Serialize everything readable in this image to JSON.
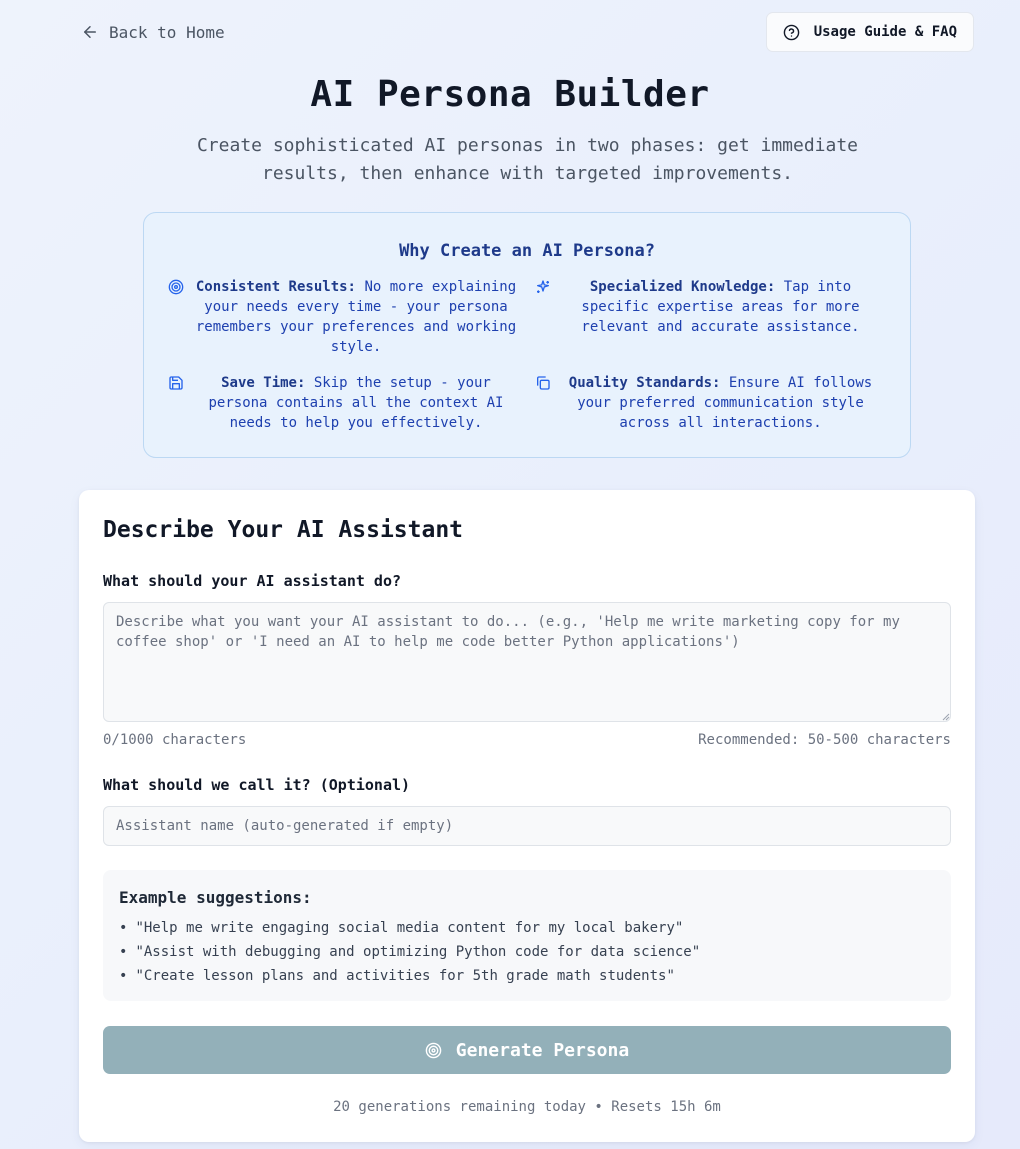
{
  "nav": {
    "back_label": "Back to Home",
    "guide_label": "Usage Guide & FAQ"
  },
  "hero": {
    "title": "AI Persona Builder",
    "subtitle": "Create sophisticated AI personas in two phases: get immediate results, then enhance with targeted improvements."
  },
  "why": {
    "title": "Why Create an AI Persona?",
    "features": [
      {
        "icon": "target-icon",
        "head": "Consistent Results:",
        "text": "No more explaining your needs every time - your persona remembers your preferences and working style."
      },
      {
        "icon": "sparkles-icon",
        "head": "Specialized Knowledge:",
        "text": "Tap into specific expertise areas for more relevant and accurate assistance."
      },
      {
        "icon": "save-icon",
        "head": "Save Time:",
        "text": "Skip the setup - your persona contains all the context AI needs to help you effectively."
      },
      {
        "icon": "copy-icon",
        "head": "Quality Standards:",
        "text": "Ensure AI follows your preferred communication style across all interactions."
      }
    ]
  },
  "form": {
    "title": "Describe Your AI Assistant",
    "task_label": "What should your AI assistant do?",
    "task_value": "",
    "task_placeholder": "Describe what you want your AI assistant to do... (e.g., 'Help me write marketing copy for my coffee shop' or 'I need an AI to help me code better Python applications')",
    "char_count": "0/1000 characters",
    "recommended": "Recommended: 50-500 characters",
    "name_label": "What should we call it? (Optional)",
    "name_value": "",
    "name_placeholder": "Assistant name (auto-generated if empty)",
    "examples_title": "Example suggestions:",
    "examples": [
      "\"Help me write engaging social media content for my local bakery\"",
      "\"Assist with debugging and optimizing Python code for data science\"",
      "\"Create lesson plans and activities for 5th grade math students\""
    ],
    "bullet": "•",
    "generate_label": "Generate Persona",
    "generate_enabled": false,
    "footnote": "20 generations remaining today • Resets 15h 6m"
  },
  "colors": {
    "accent": "#2563eb",
    "heading_blue": "#1e3a8a",
    "button_disabled": "#93b0b9"
  }
}
